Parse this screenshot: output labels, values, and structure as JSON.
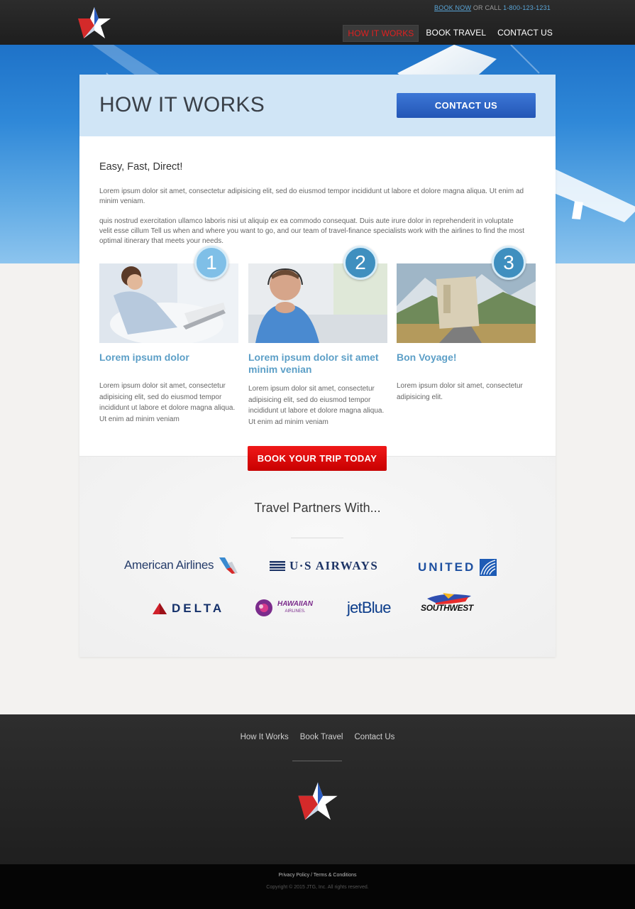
{
  "header": {
    "book_now": "BOOK NOW",
    "or_call": " OR CALL ",
    "phone": "1-800-123-1231",
    "nav": [
      {
        "label": "HOW IT WORKS"
      },
      {
        "label": "BOOK TRAVEL"
      },
      {
        "label": "CONTACT US"
      }
    ]
  },
  "main": {
    "title": "HOW IT WORKS",
    "contact_button": "CONTACT US",
    "subheading": "Easy, Fast, Direct!",
    "paragraph1": "Lorem ipsum dolor sit amet, consectetur adipisicing elit, sed do eiusmod tempor incididunt ut labore et dolore magna aliqua. Ut enim ad minim veniam.",
    "paragraph2": "quis nostrud exercitation ullamco laboris nisi ut aliquip ex ea commodo consequat. Duis aute irure dolor in reprehenderit in voluptate velit esse cillum Tell us when and where you want to go, and our team of travel-finance specialists work with the airlines to find the most optimal itinerary that meets your needs.",
    "steps": [
      {
        "number": "1",
        "title": "Lorem ipsum dolor",
        "text": "Lorem ipsum dolor sit amet, consectetur adipisicing elit, sed do eiusmod tempor incididunt ut labore et dolore magna aliqua. Ut enim ad minim veniam"
      },
      {
        "number": "2",
        "title": "Lorem ipsum dolor sit amet minim venian",
        "text": "Lorem ipsum dolor sit amet, consectetur adipisicing elit, sed do eiusmod tempor incididunt ut labore et dolore magna aliqua. Ut enim ad minim veniam"
      },
      {
        "number": "3",
        "title": "Bon Voyage!",
        "text": "Lorem ipsum dolor sit amet, consectetur adipisicing elit."
      }
    ],
    "book_button": "BOOK YOUR TRIP TODAY",
    "partners_title": "Travel Partners With...",
    "airlines": {
      "american": "American Airlines",
      "usairways": "U·S AIRWAYS",
      "united": "UNITED",
      "delta": "DELTA",
      "hawaiian": "HAWAIIAN",
      "hawaiian_sub": "AIRLINES.",
      "jetblue": "jetBlue",
      "southwest": "SOUTHWEST"
    }
  },
  "footer": {
    "nav": [
      "How It Works",
      "Book Travel",
      "Contact Us"
    ],
    "privacy": "Privacy Policy",
    "separator": " / ",
    "terms": "Terms & Conditions",
    "copyright": "Copyright © 2015 JTG, Inc. All rights reserved."
  },
  "colors": {
    "accent_blue": "#2356b6",
    "accent_red": "#e00000",
    "heading_blue": "#5c9fc7",
    "active_nav": "#e02020"
  },
  "icons": [
    "star-logo-icon",
    "numbered-step-badge",
    "american-airlines-logo",
    "us-airways-flag-icon",
    "united-globe-icon",
    "delta-widget-icon",
    "hawaiian-flower-icon",
    "southwest-plane-icon"
  ]
}
